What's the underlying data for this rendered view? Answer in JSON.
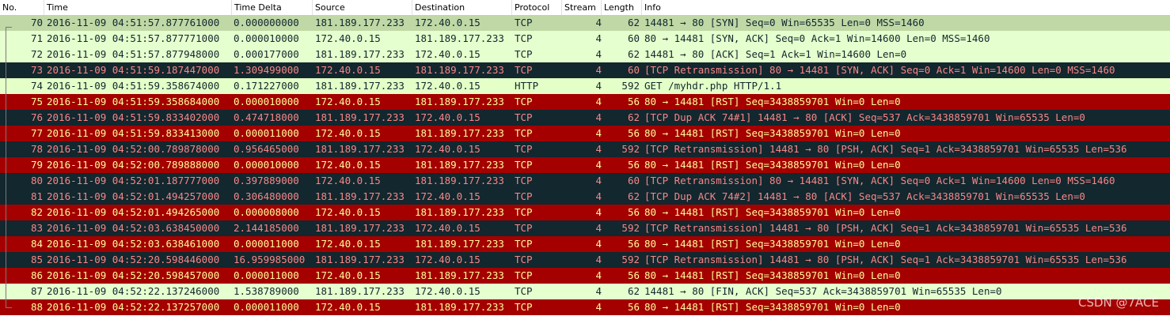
{
  "columns": {
    "no": "No.",
    "time": "Time",
    "delta": "Time Delta",
    "source": "Source",
    "destination": "Destination",
    "protocol": "Protocol",
    "stream": "Stream",
    "length": "Length",
    "info": "Info"
  },
  "colors": {
    "tcp_ok": "#e6ffce",
    "selected": "#bfd8a6",
    "http": "#e4ffc7",
    "rst": "#a40000",
    "bad_tcp": "#12272e"
  },
  "packets": [
    {
      "no": "70",
      "time": "2016-11-09 04:51:57.877761000",
      "delta": "0.000000000",
      "src": "181.189.177.233",
      "dst": "172.40.0.15",
      "proto": "TCP",
      "stream": "4",
      "len": "62",
      "info": "14481 → 80 [SYN] Seq=0 Win=65535 Len=0 MSS=1460",
      "style": "sel"
    },
    {
      "no": "71",
      "time": "2016-11-09 04:51:57.877771000",
      "delta": "0.000010000",
      "src": "172.40.0.15",
      "dst": "181.189.177.233",
      "proto": "TCP",
      "stream": "4",
      "len": "60",
      "info": "80 → 14481 [SYN, ACK] Seq=0 Ack=1 Win=14600 Len=0 MSS=1460",
      "style": "tcp-ok"
    },
    {
      "no": "72",
      "time": "2016-11-09 04:51:57.877948000",
      "delta": "0.000177000",
      "src": "181.189.177.233",
      "dst": "172.40.0.15",
      "proto": "TCP",
      "stream": "4",
      "len": "62",
      "info": "14481 → 80 [ACK] Seq=1 Ack=1 Win=14600 Len=0",
      "style": "tcp-ok"
    },
    {
      "no": "73",
      "time": "2016-11-09 04:51:59.187447000",
      "delta": "1.309499000",
      "src": "172.40.0.15",
      "dst": "181.189.177.233",
      "proto": "TCP",
      "stream": "4",
      "len": "60",
      "info": "[TCP Retransmission] 80 → 14481 [SYN, ACK] Seq=0 Ack=1 Win=14600 Len=0 MSS=1460",
      "style": "bad"
    },
    {
      "no": "74",
      "time": "2016-11-09 04:51:59.358674000",
      "delta": "0.171227000",
      "src": "181.189.177.233",
      "dst": "172.40.0.15",
      "proto": "HTTP",
      "stream": "4",
      "len": "592",
      "info": "GET /myhdr.php HTTP/1.1",
      "style": "http"
    },
    {
      "no": "75",
      "time": "2016-11-09 04:51:59.358684000",
      "delta": "0.000010000",
      "src": "172.40.0.15",
      "dst": "181.189.177.233",
      "proto": "TCP",
      "stream": "4",
      "len": "56",
      "info": "80 → 14481 [RST] Seq=3438859701 Win=0 Len=0",
      "style": "rst"
    },
    {
      "no": "76",
      "time": "2016-11-09 04:51:59.833402000",
      "delta": "0.474718000",
      "src": "181.189.177.233",
      "dst": "172.40.0.15",
      "proto": "TCP",
      "stream": "4",
      "len": "62",
      "info": "[TCP Dup ACK 74#1] 14481 → 80 [ACK] Seq=537 Ack=3438859701 Win=65535 Len=0",
      "style": "bad"
    },
    {
      "no": "77",
      "time": "2016-11-09 04:51:59.833413000",
      "delta": "0.000011000",
      "src": "172.40.0.15",
      "dst": "181.189.177.233",
      "proto": "TCP",
      "stream": "4",
      "len": "56",
      "info": "80 → 14481 [RST] Seq=3438859701 Win=0 Len=0",
      "style": "rst"
    },
    {
      "no": "78",
      "time": "2016-11-09 04:52:00.789878000",
      "delta": "0.956465000",
      "src": "181.189.177.233",
      "dst": "172.40.0.15",
      "proto": "TCP",
      "stream": "4",
      "len": "592",
      "info": "[TCP Retransmission] 14481 → 80 [PSH, ACK] Seq=1 Ack=3438859701 Win=65535 Len=536",
      "style": "bad"
    },
    {
      "no": "79",
      "time": "2016-11-09 04:52:00.789888000",
      "delta": "0.000010000",
      "src": "172.40.0.15",
      "dst": "181.189.177.233",
      "proto": "TCP",
      "stream": "4",
      "len": "56",
      "info": "80 → 14481 [RST] Seq=3438859701 Win=0 Len=0",
      "style": "rst"
    },
    {
      "no": "80",
      "time": "2016-11-09 04:52:01.187777000",
      "delta": "0.397889000",
      "src": "172.40.0.15",
      "dst": "181.189.177.233",
      "proto": "TCP",
      "stream": "4",
      "len": "60",
      "info": "[TCP Retransmission] 80 → 14481 [SYN, ACK] Seq=0 Ack=1 Win=14600 Len=0 MSS=1460",
      "style": "bad"
    },
    {
      "no": "81",
      "time": "2016-11-09 04:52:01.494257000",
      "delta": "0.306480000",
      "src": "181.189.177.233",
      "dst": "172.40.0.15",
      "proto": "TCP",
      "stream": "4",
      "len": "62",
      "info": "[TCP Dup ACK 74#2] 14481 → 80 [ACK] Seq=537 Ack=3438859701 Win=65535 Len=0",
      "style": "bad"
    },
    {
      "no": "82",
      "time": "2016-11-09 04:52:01.494265000",
      "delta": "0.000008000",
      "src": "172.40.0.15",
      "dst": "181.189.177.233",
      "proto": "TCP",
      "stream": "4",
      "len": "56",
      "info": "80 → 14481 [RST] Seq=3438859701 Win=0 Len=0",
      "style": "rst"
    },
    {
      "no": "83",
      "time": "2016-11-09 04:52:03.638450000",
      "delta": "2.144185000",
      "src": "181.189.177.233",
      "dst": "172.40.0.15",
      "proto": "TCP",
      "stream": "4",
      "len": "592",
      "info": "[TCP Retransmission] 14481 → 80 [PSH, ACK] Seq=1 Ack=3438859701 Win=65535 Len=536",
      "style": "bad"
    },
    {
      "no": "84",
      "time": "2016-11-09 04:52:03.638461000",
      "delta": "0.000011000",
      "src": "172.40.0.15",
      "dst": "181.189.177.233",
      "proto": "TCP",
      "stream": "4",
      "len": "56",
      "info": "80 → 14481 [RST] Seq=3438859701 Win=0 Len=0",
      "style": "rst"
    },
    {
      "no": "85",
      "time": "2016-11-09 04:52:20.598446000",
      "delta": "16.959985000",
      "src": "181.189.177.233",
      "dst": "172.40.0.15",
      "proto": "TCP",
      "stream": "4",
      "len": "592",
      "info": "[TCP Retransmission] 14481 → 80 [PSH, ACK] Seq=1 Ack=3438859701 Win=65535 Len=536",
      "style": "bad"
    },
    {
      "no": "86",
      "time": "2016-11-09 04:52:20.598457000",
      "delta": "0.000011000",
      "src": "172.40.0.15",
      "dst": "181.189.177.233",
      "proto": "TCP",
      "stream": "4",
      "len": "56",
      "info": "80 → 14481 [RST] Seq=3438859701 Win=0 Len=0",
      "style": "rst"
    },
    {
      "no": "87",
      "time": "2016-11-09 04:52:22.137246000",
      "delta": "1.538789000",
      "src": "181.189.177.233",
      "dst": "172.40.0.15",
      "proto": "TCP",
      "stream": "4",
      "len": "62",
      "info": "14481 → 80 [FIN, ACK] Seq=537 Ack=3438859701 Win=65535 Len=0",
      "style": "tcp-ok"
    },
    {
      "no": "88",
      "time": "2016-11-09 04:52:22.137257000",
      "delta": "0.000011000",
      "src": "172.40.0.15",
      "dst": "181.189.177.233",
      "proto": "TCP",
      "stream": "4",
      "len": "56",
      "info": "80 → 14481 [RST] Seq=3438859701 Win=0 Len=0",
      "style": "rst"
    }
  ],
  "watermark": "CSDN @7ACE"
}
